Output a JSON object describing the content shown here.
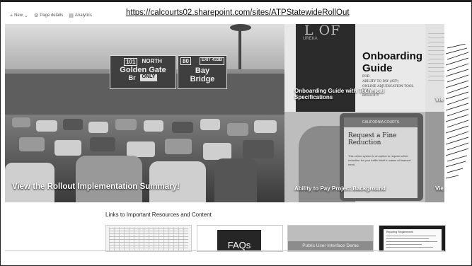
{
  "page": {
    "url": "https://calcourts02.sharepoint.com/sites/ATPStatewideRollOut"
  },
  "command_bar": {
    "new_label": "New",
    "page_details_label": "Page details",
    "analytics_label": "Analytics"
  },
  "hero": {
    "label": "View the Rollout Implementation Summary!",
    "sign_shield": "101",
    "sign_dir": "NORTH",
    "sign_dest1": "Golden Gate",
    "sign_dest1b": "Br",
    "sign_only": "ONLY",
    "sign_shield2": "80",
    "sign_exit": "EXIT",
    "sign_exit_num": "433B",
    "sign_dest2": "Bay",
    "sign_dest2b": "Bridge"
  },
  "tiles": {
    "onboarding": {
      "label": "Onboarding Guide with Technical Specifications",
      "doc_title": "Onboarding Guide",
      "seal_text": "L OF",
      "seal_sub": "UREKA",
      "doc_lines": [
        "FOR",
        "ABILITY TO PAY (ATP)",
        "ONLINE ADJUDICATION TOOL",
        "TOOL",
        "ROLLOUT"
      ]
    },
    "top_right": {
      "label": "Vie"
    },
    "ability": {
      "label": "Ability to Pay Project Background",
      "screen_header": "CALIFORNIA COURTS",
      "screen_title": "Request a Fine Reduction",
      "screen_body": "This online system is an option to request a fine reduction for your traffic ticket in cases of financial need."
    },
    "bottom_right": {
      "label": "Vie"
    }
  },
  "links_section": {
    "title": "Links to Important Resources and Content",
    "items": [
      {
        "label": ""
      },
      {
        "label": "FAQs"
      },
      {
        "label": "Public User Interface Demo"
      },
      {
        "label": "Reporting Requirements"
      }
    ]
  }
}
